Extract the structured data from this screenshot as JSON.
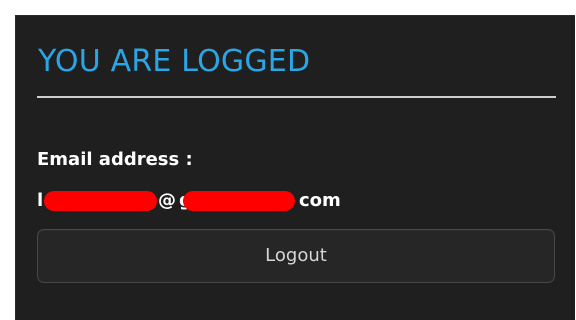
{
  "panel": {
    "title": "YOU ARE LOGGED",
    "email_label": "Email address :",
    "email_value": {
      "prefix": "l",
      "at": "@",
      "at_domain_start": "g",
      "suffix": "com"
    },
    "logout_label": "Logout"
  },
  "colors": {
    "panel_background": "#1f1f1f",
    "title": "#2aa6e6",
    "text": "#ffffff",
    "redaction": "#ff0000",
    "button_background": "#262626",
    "button_border": "#474747"
  }
}
